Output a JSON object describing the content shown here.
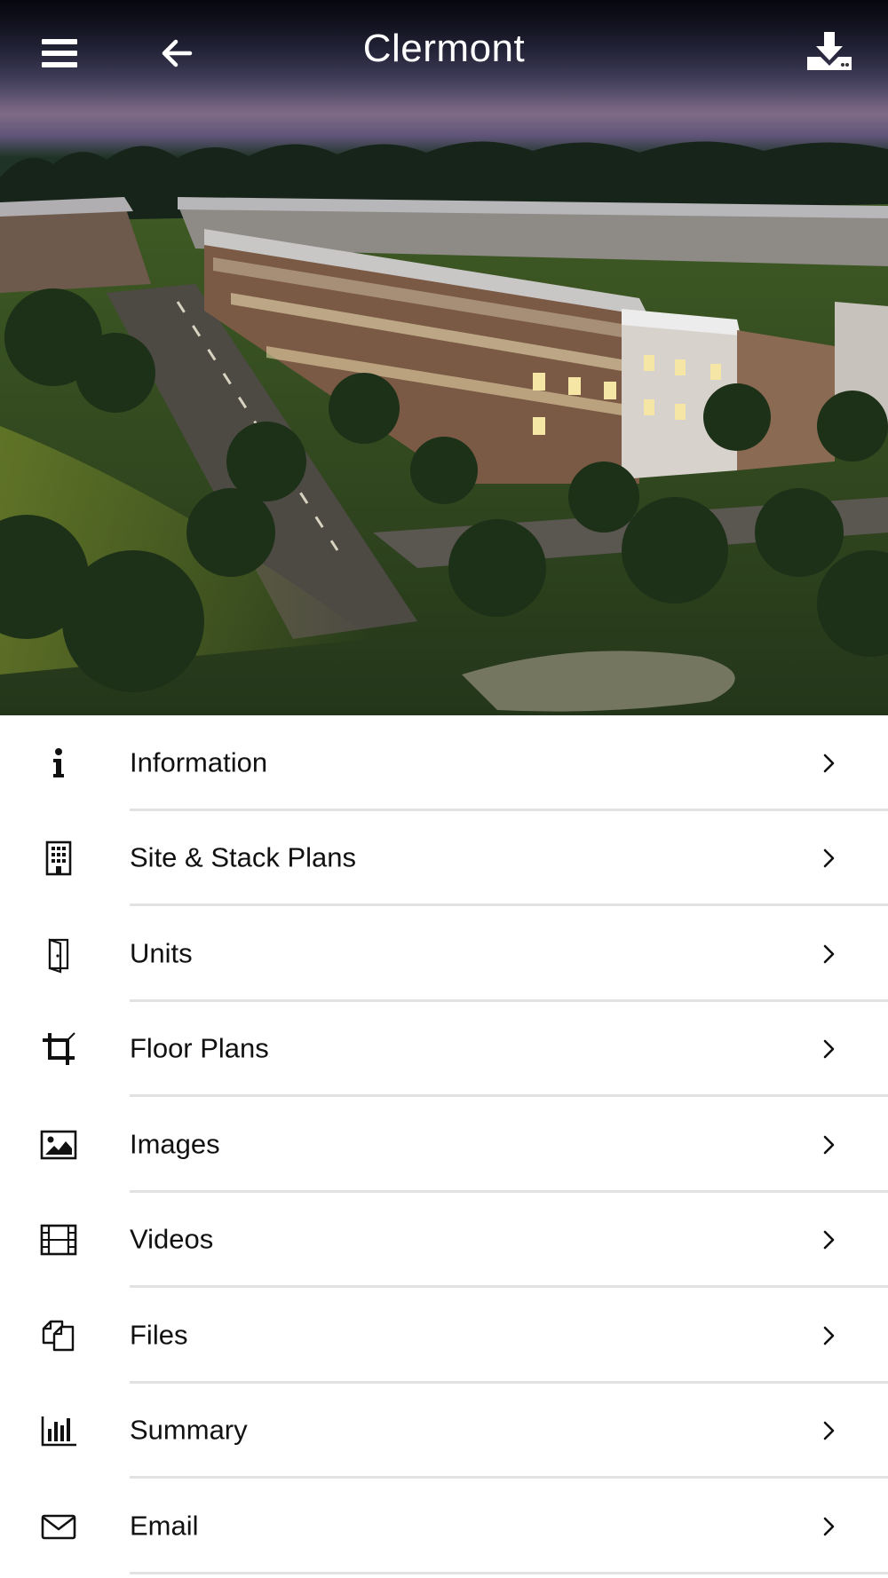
{
  "header": {
    "title": "Clermont",
    "menu_icon": "hamburger-menu-icon",
    "back_icon": "arrow-left-icon",
    "download_icon": "download-icon"
  },
  "hero": {
    "description_icon": "project-render-image"
  },
  "menu": {
    "items": [
      {
        "label": "Information",
        "icon": "info-icon"
      },
      {
        "label": "Site & Stack Plans",
        "icon": "building-icon"
      },
      {
        "label": "Units",
        "icon": "door-icon"
      },
      {
        "label": "Floor Plans",
        "icon": "crop-icon"
      },
      {
        "label": "Images",
        "icon": "image-icon"
      },
      {
        "label": "Videos",
        "icon": "film-icon"
      },
      {
        "label": "Files",
        "icon": "files-icon"
      },
      {
        "label": "Summary",
        "icon": "bar-chart-icon"
      },
      {
        "label": "Email",
        "icon": "envelope-icon"
      }
    ]
  },
  "colors": {
    "text": "#111111",
    "separator": "#e2e2e2",
    "header_text": "#ffffff"
  }
}
